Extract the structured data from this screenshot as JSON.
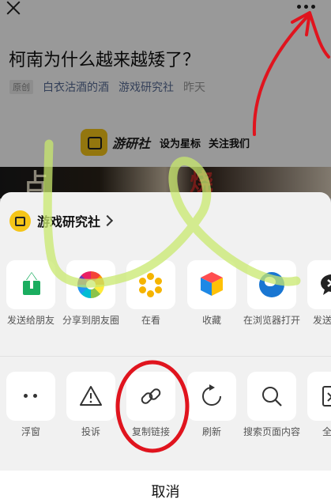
{
  "article": {
    "title": "柯南为什么越来越矮了？",
    "badge": "原创",
    "author": "白衣沽酒的酒",
    "account": "游戏研究社",
    "time": "昨天",
    "banner_logo_text": "游研社",
    "banner_star": "设为星标",
    "banner_follow": "关注我们",
    "poster_text_left": "占",
    "poster_text_right": "烧"
  },
  "sheet": {
    "account_name": "游戏研究社",
    "row1": [
      {
        "icon": "wechat-share-icon",
        "label": "发送给朋友"
      },
      {
        "icon": "moments-icon",
        "label": "分享到朋友圈"
      },
      {
        "icon": "wow-icon",
        "label": "在看"
      },
      {
        "icon": "favorite-cube-icon",
        "label": "收藏"
      },
      {
        "icon": "browser-globe-icon",
        "label": "在浏览器打开"
      },
      {
        "icon": "send-to-chat-icon",
        "label": "发送到企"
      }
    ],
    "row2": [
      {
        "icon": "float-window-icon",
        "label": "浮窗"
      },
      {
        "icon": "warning-icon",
        "label": "投诉"
      },
      {
        "icon": "link-icon",
        "label": "复制链接"
      },
      {
        "icon": "refresh-icon",
        "label": "刷新"
      },
      {
        "icon": "search-icon",
        "label": "搜索页面内容"
      },
      {
        "icon": "fulltext-icon",
        "label": "全文"
      }
    ],
    "cancel_label": "取消"
  },
  "annotation_colors": {
    "red_marker": "#e0141e",
    "green_marker": "#c8e86e"
  }
}
